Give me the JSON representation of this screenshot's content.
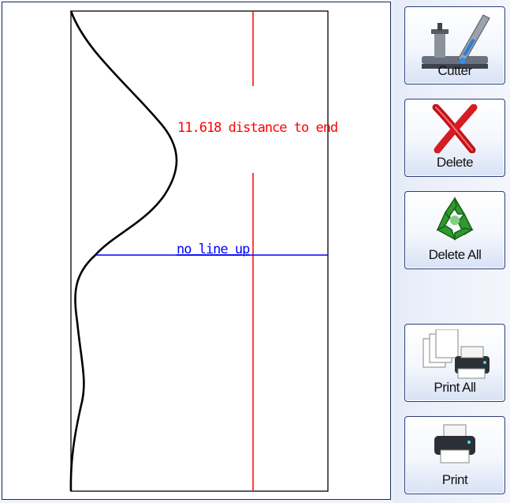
{
  "canvas": {
    "distance_label": "11.618 distance to end",
    "lineup_label": "no line up",
    "colors": {
      "profile": "#000000",
      "center_line": "#ff0000",
      "lineup_line": "#0000ff"
    }
  },
  "toolbar": {
    "cutter_label": "Cutter",
    "delete_label": "Delete",
    "delete_all_label": "Delete All",
    "print_all_label": "Print All",
    "print_label": "Print"
  }
}
